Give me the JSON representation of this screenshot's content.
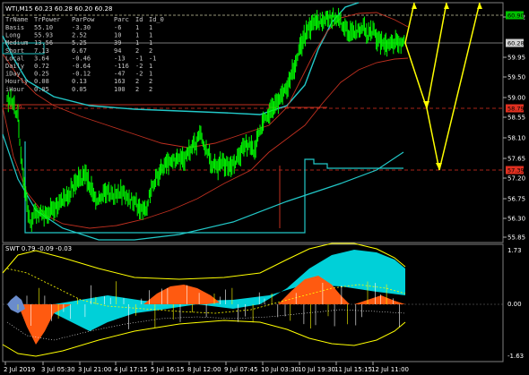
{
  "header": {
    "symbol_line": "WTI,M15  60.23 60.28 60.20 60.28"
  },
  "info_table": {
    "columns": [
      "TrName",
      "TrPower",
      "ParPow",
      "Parc",
      "Id",
      "Id_0"
    ],
    "rows": [
      [
        "Basis",
        "55.10",
        "-3.30",
        "-6",
        "1",
        "1"
      ],
      [
        "Long",
        "55.93",
        "2.52",
        "10",
        "1",
        "1"
      ],
      [
        "Medium",
        "13.56",
        "5.25",
        "39",
        "1",
        "1"
      ],
      [
        "Short",
        "7.13",
        "6.67",
        "94",
        "2",
        "2"
      ],
      [
        "Local",
        "3.64",
        "-0.46",
        "-13",
        "-1",
        "-1"
      ],
      [
        "Daily",
        "0.72",
        "-0.64",
        "-116",
        "-2",
        "1"
      ],
      [
        "iDay",
        "0.25",
        "-0.12",
        "-47",
        "-2",
        "1"
      ],
      [
        "Hourly",
        "0.08",
        "0.13",
        "163",
        "2",
        "2"
      ],
      [
        "iHour",
        "0.05",
        "0.05",
        "100",
        "2",
        "2"
      ]
    ]
  },
  "price_axis": {
    "labels": [
      "60.42",
      "59.95",
      "59.50",
      "59.00",
      "58.55",
      "58.10",
      "57.65",
      "57.20",
      "56.75",
      "56.30",
      "55.85"
    ],
    "tags": [
      {
        "label": "60.90",
        "color": "#00c000"
      },
      {
        "label": "60.28",
        "color": "#d0d0d0"
      },
      {
        "label": "58.79",
        "color": "#e03020"
      },
      {
        "label": "57.39",
        "color": "#e03020"
      }
    ],
    "level_labels": {
      "left_level": "58.79"
    }
  },
  "oscillator": {
    "title": "SWT 0.79 -0.09 -0.03",
    "axis_labels": [
      "1.73",
      "0.00",
      "-1.63"
    ]
  },
  "time_axis": {
    "labels": [
      "2 Jul 2019",
      "3 Jul 05:30",
      "3 Jul 21:00",
      "4 Jul 17:15",
      "5 Jul 16:15",
      "8 Jul 12:00",
      "9 Jul 07:45",
      "10 Jul 03:30",
      "10 Jul 19:30",
      "11 Jul 15:15",
      "12 Jul 11:00"
    ]
  },
  "colors": {
    "candles": "#00ff00",
    "ma_cyan": "#22c8c8",
    "envelope": "#c03020",
    "projection": "#ffff00",
    "osc_cyan": "#00d0d8",
    "osc_orange": "#ff5a10",
    "osc_yellow": "#ffff00"
  }
}
